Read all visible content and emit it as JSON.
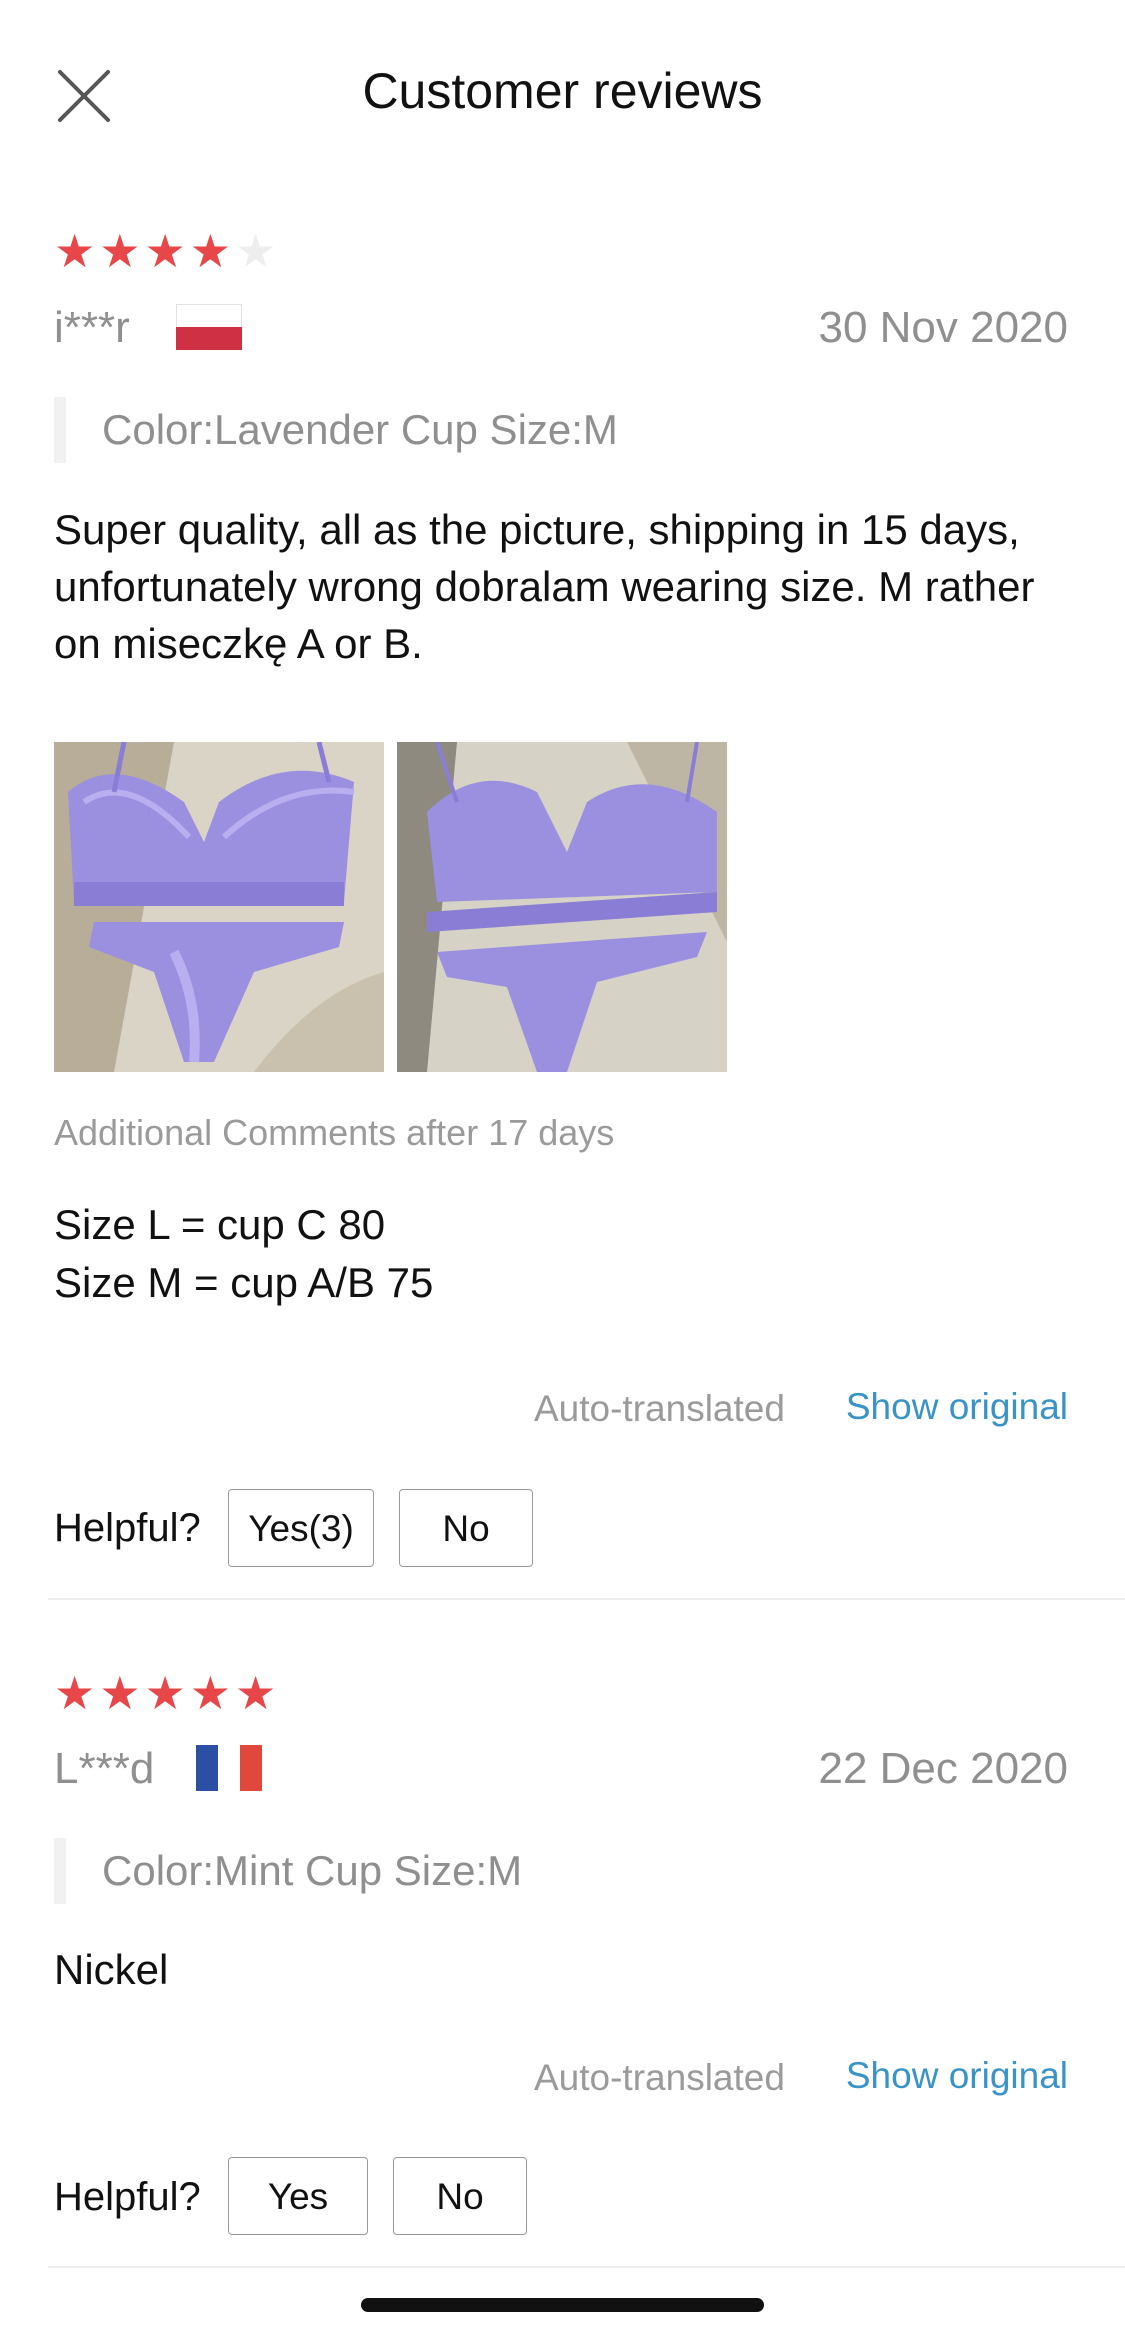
{
  "header": {
    "title": "Customer reviews",
    "close_icon": "close-icon"
  },
  "reviews": [
    {
      "rating": 4,
      "max_rating": 5,
      "user": "i***r",
      "flag": "poland-flag",
      "date": "30 Nov 2020",
      "variant": "Color:Lavender Cup Size:M",
      "text": "Super quality, all as the picture, shipping in 15 days, unfortunately wrong dobralam wearing size. M rather on miseczkę A or B.",
      "photos": [
        "review-photo-1",
        "review-photo-2"
      ],
      "additional_label": "Additional Comments after 17 days",
      "additional_lines": [
        "Size L = cup C 80",
        "Size M = cup A/B 75"
      ],
      "auto_translated": "Auto-translated",
      "show_original": "Show original",
      "helpful_label": "Helpful?",
      "yes_label": "Yes(3)",
      "no_label": "No"
    },
    {
      "rating": 5,
      "max_rating": 5,
      "user": "L***d",
      "flag": "france-flag",
      "date": "22 Dec 2020",
      "variant": "Color:Mint Cup Size:M",
      "text": "Nickel",
      "auto_translated": "Auto-translated",
      "show_original": "Show original",
      "helpful_label": "Helpful?",
      "yes_label": "Yes",
      "no_label": "No"
    }
  ],
  "colors": {
    "star": "#e8474a",
    "link": "#3a93c6",
    "muted": "#8f8f8f",
    "photo_lavender": "#9b8fe0"
  }
}
